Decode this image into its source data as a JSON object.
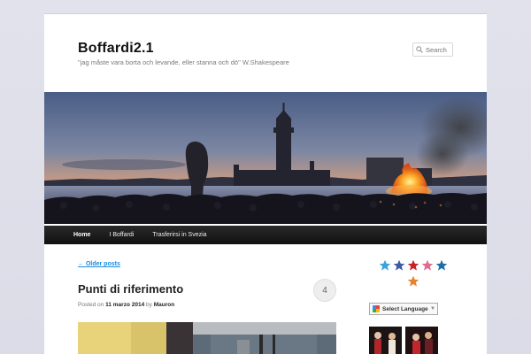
{
  "site": {
    "title": "Boffardi2.1",
    "description": "\"jag måste vara borta och levande, eller stanna och dö\" W.Shakespeare"
  },
  "search": {
    "placeholder": "Search"
  },
  "nav": {
    "items": [
      {
        "label": "Home",
        "active": true
      },
      {
        "label": "I Boffardi",
        "active": false
      },
      {
        "label": "Trasferirsi in Svezia",
        "active": false
      }
    ]
  },
  "content": {
    "older_posts": "← Older posts",
    "post": {
      "title": "Punti di riferimento",
      "meta_prefix": "Posted on",
      "date": "11 marzo 2014",
      "by": "by",
      "author": "Mauron",
      "comments": "4"
    }
  },
  "sidebar": {
    "social_icons": [
      {
        "name": "twitter-icon",
        "color": "#3aa3d8"
      },
      {
        "name": "facebook-icon",
        "color": "#3b5ba8"
      },
      {
        "name": "pinterest-icon",
        "color": "#cc2127"
      },
      {
        "name": "flickr-icon",
        "color": "#e06b8f"
      },
      {
        "name": "linkedin-icon",
        "color": "#1d6da8"
      },
      {
        "name": "rss-icon",
        "color": "#e8822a"
      }
    ],
    "language": "Select Language",
    "language_arrow": "▼"
  },
  "colors": {
    "accent": "#1b8be0",
    "nav_bg": "#1a1a1a",
    "bonfire": "#ff7a1a"
  }
}
